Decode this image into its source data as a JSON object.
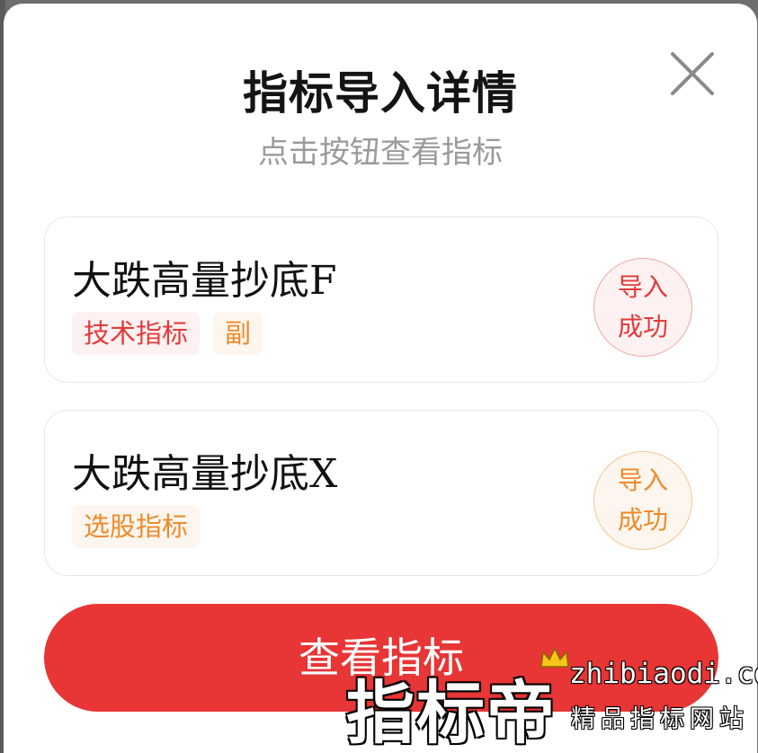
{
  "dialog": {
    "title": "指标导入详情",
    "subtitle": "点击按钮查看指标",
    "close_icon": "close-icon"
  },
  "cards": [
    {
      "name": "大跌高量抄底F",
      "tags": [
        {
          "label": "技术指标",
          "color": "#e23b3b"
        },
        {
          "label": "副",
          "color": "#ee8a2a"
        }
      ],
      "status_line1": "导入",
      "status_line2": "成功",
      "status_color": "#e23b3b"
    },
    {
      "name": "大跌高量抄底X",
      "tags": [
        {
          "label": "选股指标",
          "color": "#ee8a2a"
        }
      ],
      "status_line1": "导入",
      "status_line2": "成功",
      "status_color": "#ee8a2a"
    }
  ],
  "action": {
    "view_label": "查看指标",
    "color": "#e83535"
  },
  "watermark": {
    "logo_text": "指标帝",
    "domain": "zhibiaodi.com",
    "slogan": "精品指标网站",
    "crown_icon": "crown-icon"
  }
}
